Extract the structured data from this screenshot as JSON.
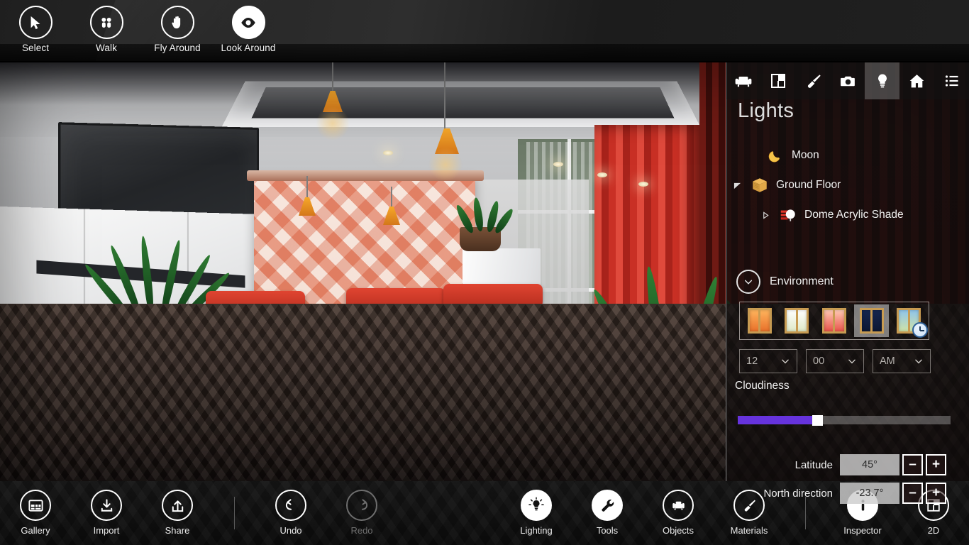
{
  "top_toolbar": {
    "items": [
      {
        "label": "Select",
        "icon": "cursor-arrow-icon",
        "active": false
      },
      {
        "label": "Walk",
        "icon": "footsteps-icon",
        "active": false
      },
      {
        "label": "Fly Around",
        "icon": "hand-icon",
        "active": false
      },
      {
        "label": "Look Around",
        "icon": "eye-icon",
        "active": true
      }
    ]
  },
  "panel": {
    "tabs": [
      {
        "name": "furniture",
        "icon": "sofa-icon",
        "active": false
      },
      {
        "name": "floorplan",
        "icon": "floorplan-icon",
        "active": false
      },
      {
        "name": "materials",
        "icon": "paintbrush-icon",
        "active": false
      },
      {
        "name": "camera",
        "icon": "camera-icon",
        "active": false
      },
      {
        "name": "lights",
        "icon": "lightbulb-icon",
        "active": true
      },
      {
        "name": "home",
        "icon": "home-icon",
        "active": false
      },
      {
        "name": "list",
        "icon": "list-icon",
        "active": false
      }
    ],
    "title": "Lights",
    "tree": [
      {
        "label": "Moon",
        "icon": "moon-icon",
        "indent": 0,
        "twisty": ""
      },
      {
        "label": "Ground Floor",
        "icon": "box-icon",
        "indent": 0,
        "twisty": "expanded"
      },
      {
        "label": "Dome Acrylic Shade",
        "icon": "lamp-icon",
        "indent": 1,
        "twisty": "collapsed"
      }
    ],
    "environment": {
      "section_label": "Environment",
      "presets": [
        {
          "name": "preset-sunset",
          "selected": false,
          "badge": ""
        },
        {
          "name": "preset-daylight",
          "selected": false,
          "badge": ""
        },
        {
          "name": "preset-dawn",
          "selected": false,
          "badge": ""
        },
        {
          "name": "preset-night",
          "selected": true,
          "badge": ""
        },
        {
          "name": "preset-custom-time",
          "selected": false,
          "badge": "clock-icon"
        }
      ],
      "time": {
        "hour": "12",
        "minute": "00",
        "meridiem": "AM"
      },
      "cloudiness": {
        "label": "Cloudiness",
        "value_percent": 35
      },
      "latitude": {
        "label": "Latitude",
        "value": "45°",
        "minus": "–",
        "plus": "+"
      },
      "north_direction": {
        "label": "North direction",
        "value": "-23.7°",
        "minus": "–",
        "plus": "+"
      }
    }
  },
  "viewport": {
    "collapse_handle": "chevron-up-icon"
  },
  "bottom_bar": {
    "left_items": [
      {
        "label": "Gallery",
        "icon": "gallery-icon",
        "style": "outline",
        "disabled": false
      },
      {
        "label": "Import",
        "icon": "import-icon",
        "style": "outline",
        "disabled": false
      },
      {
        "label": "Share",
        "icon": "share-icon",
        "style": "outline",
        "disabled": false
      },
      {
        "label": "Undo",
        "icon": "undo-icon",
        "style": "outline",
        "disabled": false
      },
      {
        "label": "Redo",
        "icon": "redo-icon",
        "style": "outline",
        "disabled": true
      }
    ],
    "right_items": [
      {
        "label": "Lighting",
        "icon": "lightbulb-icon",
        "style": "filled",
        "disabled": false
      },
      {
        "label": "Tools",
        "icon": "wrench-icon",
        "style": "filled",
        "disabled": false
      },
      {
        "label": "Objects",
        "icon": "sofa-icon",
        "style": "outline",
        "disabled": false
      },
      {
        "label": "Materials",
        "icon": "paintbrush-icon",
        "style": "outline",
        "disabled": false
      },
      {
        "label": "Inspector",
        "icon": "info-icon",
        "style": "filled",
        "disabled": false
      },
      {
        "label": "2D",
        "icon": "floorplan-icon",
        "style": "outline",
        "disabled": false
      }
    ]
  },
  "colors": {
    "accent_slider": "#6633dd",
    "panel_bg": "#0e0e0e",
    "toolbar_bg": "#1f1f1f",
    "text": "#f0f0f0"
  }
}
